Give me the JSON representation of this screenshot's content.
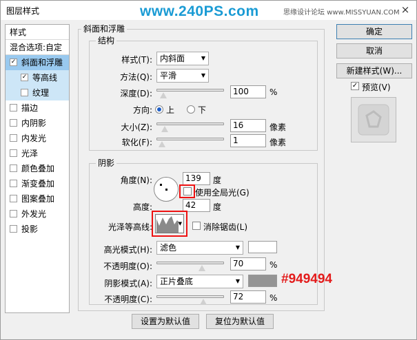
{
  "title": "图层样式",
  "watermark": "www.240PS.com",
  "site": "思缘设计论坛 www.MISSYUAN.COM",
  "close": "×",
  "left": {
    "header": "样式",
    "blend": "混合选项:自定",
    "items": [
      {
        "label": "斜面和浮雕",
        "checked": true
      },
      {
        "label": "等高线",
        "checked": true
      },
      {
        "label": "纹理",
        "checked": false
      },
      {
        "label": "描边",
        "checked": false
      },
      {
        "label": "内阴影",
        "checked": false
      },
      {
        "label": "内发光",
        "checked": false
      },
      {
        "label": "光泽",
        "checked": false
      },
      {
        "label": "颜色叠加",
        "checked": false
      },
      {
        "label": "渐变叠加",
        "checked": false
      },
      {
        "label": "图案叠加",
        "checked": false
      },
      {
        "label": "外发光",
        "checked": false
      },
      {
        "label": "投影",
        "checked": false
      }
    ],
    "check_mark": "✓"
  },
  "main": {
    "section": "斜面和浮雕",
    "structure": {
      "title": "结构",
      "style_label": "样式(T):",
      "style_value": "内斜面",
      "method_label": "方法(Q):",
      "method_value": "平滑",
      "depth_label": "深度(D):",
      "depth_value": "100",
      "depth_unit": "%",
      "depth_level": 0.05,
      "direction_label": "方向:",
      "dir_up": "上",
      "dir_down": "下",
      "size_label": "大小(Z):",
      "size_value": "16",
      "size_unit": "像素",
      "size_level": 0.07,
      "soften_label": "软化(F):",
      "soften_value": "1",
      "soften_unit": "像素",
      "soften_level": 0.02
    },
    "shading": {
      "title": "阴影",
      "angle_label": "角度(N):",
      "angle_value": "139",
      "angle_unit": "度",
      "global_light": "使用全局光(G)",
      "altitude_label": "高度:",
      "altitude_value": "42",
      "altitude_unit": "度",
      "gloss_label": "光泽等高线:",
      "antialias": "消除锯齿(L)",
      "highlight_label": "高光模式(H):",
      "highlight_value": "滤色",
      "highlight_color": "#ffffff",
      "hl_opacity_label": "不透明度(O):",
      "hl_opacity_value": "70",
      "hl_opacity_unit": "%",
      "hl_level": 0.7,
      "shadow_label": "阴影模式(A):",
      "shadow_value": "正片叠底",
      "shadow_color": "#949494",
      "annotation": "#949494",
      "sh_opacity_label": "不透明度(C):",
      "sh_opacity_value": "72",
      "sh_opacity_unit": "%",
      "sh_level": 0.72
    },
    "make_default": "设置为默认值",
    "reset_default": "复位为默认值"
  },
  "right": {
    "ok": "确定",
    "cancel": "取消",
    "new_style": "新建样式(W)...",
    "preview": "预览(V)"
  }
}
